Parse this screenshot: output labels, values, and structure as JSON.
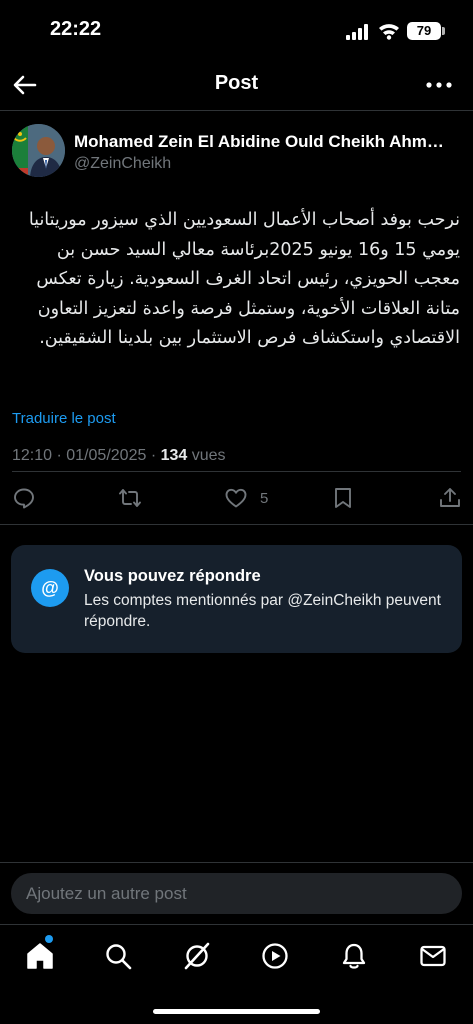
{
  "status_bar": {
    "time": "22:22",
    "battery": "79",
    "icons": [
      "cellular-signal-icon",
      "wifi-icon",
      "battery-icon"
    ]
  },
  "header": {
    "title": "Post",
    "icons": [
      "back-arrow-icon",
      "more-options-icon"
    ]
  },
  "post": {
    "author_name": "Mohamed Zein El Abidine Ould Cheikh Ahm…",
    "author_handle": "@ZeinCheikh",
    "text": "نرحب بوفد أصحاب الأعمال السعوديين الذي سيزور موريتانيا يومي 15 و16 يونيو 2025برئاسة معالي السيد حسن بن معجب الحويزي، رئيس اتحاد الغرف السعودية. زيارة تعكس متانة العلاقات الأخوية، وستمثل فرصة واعدة لتعزيز التعاون الاقتصادي واستكشاف فرص الاستثمار بين بلدينا الشقيقين.",
    "translate_label": "Traduire le post",
    "time": "12:10",
    "separator": "·",
    "date": "01/05/2025",
    "views_count": "134",
    "views_label": "vues",
    "like_count": "5",
    "actions": [
      "reply-icon",
      "repost-icon",
      "like-icon",
      "bookmark-icon",
      "share-icon"
    ]
  },
  "reply_notice": {
    "badge": "@",
    "title": "Vous pouvez répondre",
    "description": "Les comptes mentionnés par @ZeinCheikh peuvent répondre."
  },
  "compose": {
    "placeholder": "Ajoutez un autre post"
  },
  "bottom_nav": {
    "items": [
      "home-icon",
      "search-icon",
      "grok-icon",
      "video-icon",
      "notifications-icon",
      "messages-icon"
    ]
  },
  "colors": {
    "background": "#000000",
    "accent": "#1d9bf0",
    "card": "#16202c",
    "muted": "#71767b",
    "text": "#e7e9ea"
  }
}
